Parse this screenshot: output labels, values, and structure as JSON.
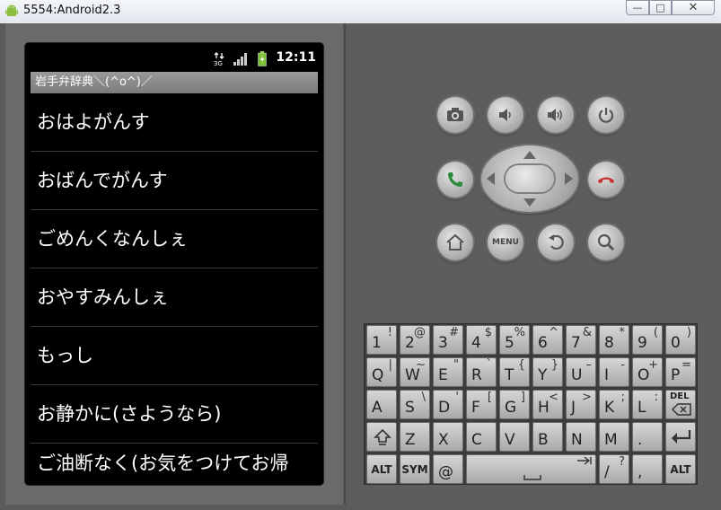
{
  "window": {
    "title": "5554:Android2.3",
    "min_glyph": "—",
    "max_glyph": "□",
    "close_glyph": "✕"
  },
  "status": {
    "time": "12:11",
    "network_label": "3G"
  },
  "app": {
    "title": "岩手弁辞典＼(^o^)／"
  },
  "list": [
    "おはよがんす",
    "おばんでがんす",
    "ごめんくなんしぇ",
    "おやすみんしぇ",
    "もっし",
    "お静かに(さようなら)",
    "ご油断なく(お気をつけてお帰"
  ],
  "controls": {
    "menu_label": "MENU"
  },
  "keyboard": {
    "row1": [
      [
        "1",
        "!"
      ],
      [
        "2",
        "@"
      ],
      [
        "3",
        "#"
      ],
      [
        "4",
        "$"
      ],
      [
        "5",
        "%"
      ],
      [
        "6",
        "^"
      ],
      [
        "7",
        "&"
      ],
      [
        "8",
        "*"
      ],
      [
        "9",
        "("
      ],
      [
        "0",
        ")"
      ]
    ],
    "row2": [
      [
        "Q",
        "|"
      ],
      [
        "W",
        "~"
      ],
      [
        "E",
        "\""
      ],
      [
        "R",
        "`"
      ],
      [
        "T",
        "{"
      ],
      [
        "Y",
        "}"
      ],
      [
        "U",
        "–"
      ],
      [
        "I",
        "-"
      ],
      [
        "O",
        "+"
      ],
      [
        "P",
        "="
      ]
    ],
    "row3": [
      [
        "A",
        ""
      ],
      [
        "S",
        "\\"
      ],
      [
        "D",
        "'"
      ],
      [
        "F",
        "["
      ],
      [
        "G",
        "]"
      ],
      [
        "H",
        "<"
      ],
      [
        "J",
        ">"
      ],
      [
        "K",
        ";"
      ],
      [
        "L",
        ":"
      ]
    ],
    "row4": [
      [
        "Z",
        ""
      ],
      [
        "X",
        ""
      ],
      [
        "C",
        ""
      ],
      [
        "V",
        ""
      ],
      [
        "B",
        ""
      ],
      [
        "N",
        ""
      ],
      [
        "M",
        ""
      ],
      [
        ".",
        ""
      ]
    ],
    "del_label": "DEL",
    "alt_label": "ALT",
    "sym_label": "SYM",
    "at_label": "@",
    "slash_label": "/",
    "question_label": "?",
    "comma_label": ","
  }
}
